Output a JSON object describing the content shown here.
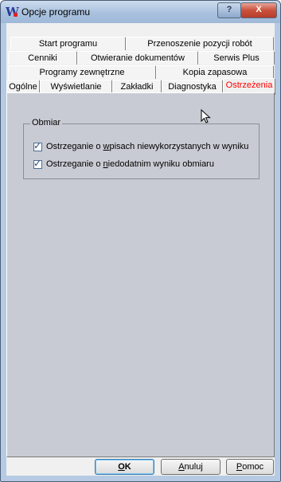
{
  "window": {
    "title": "Opcje programu"
  },
  "titlebar": {
    "help_label": "?",
    "close_label": "X"
  },
  "tabs": {
    "row1": [
      {
        "label": "Start programu"
      },
      {
        "label": "Przenoszenie pozycji robót"
      }
    ],
    "row2": [
      {
        "label": "Cenniki"
      },
      {
        "label": "Otwieranie dokumentów"
      },
      {
        "label": "Serwis Plus"
      }
    ],
    "row3": [
      {
        "label": "Programy zewnętrzne"
      },
      {
        "label": "Kopia zapasowa"
      }
    ],
    "row4": [
      {
        "label": "Ogólne"
      },
      {
        "label": "Wyświetlanie"
      },
      {
        "label": "Zakładki"
      },
      {
        "label": "Diagnostyka"
      },
      {
        "label": "Ostrzeżenia",
        "active": true
      }
    ]
  },
  "group": {
    "title": "Obmiar",
    "options": [
      {
        "prefix": "Ostrzeganie o ",
        "accel": "w",
        "suffix": "pisach niewykorzystanych w wyniku",
        "checked": true
      },
      {
        "prefix": "Ostrzeganie o ",
        "accel": "n",
        "suffix": "iedodatnim wyniku obmiaru",
        "checked": true
      }
    ]
  },
  "buttons": {
    "ok": {
      "accel": "O",
      "rest": "K"
    },
    "cancel": {
      "accel": "A",
      "rest": "nuluj"
    },
    "help": {
      "accel": "P",
      "rest": "omoc"
    }
  },
  "icons": {
    "app": "program-logo-icon",
    "cursor": "mouse-pointer-icon",
    "check": "checkmark-icon"
  }
}
